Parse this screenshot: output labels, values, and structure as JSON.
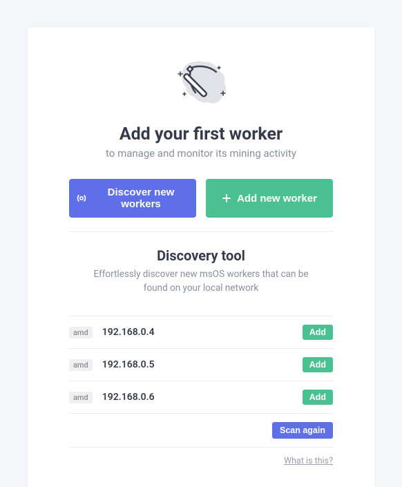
{
  "hero": {
    "title": "Add your first worker",
    "subtitle": "to manage and monitor its mining activity"
  },
  "buttons": {
    "discover": "Discover new workers",
    "add": "Add new worker"
  },
  "discovery": {
    "title": "Discovery tool",
    "subtitle": "Effortlessly discover new msOS workers that can be found on your local network",
    "add_label": "Add",
    "scan_label": "Scan again",
    "workers": [
      {
        "badge": "amd",
        "ip": "192.168.0.4"
      },
      {
        "badge": "amd",
        "ip": "192.168.0.5"
      },
      {
        "badge": "amd",
        "ip": "192.168.0.6"
      }
    ]
  },
  "footer": {
    "help": "What is this?"
  }
}
